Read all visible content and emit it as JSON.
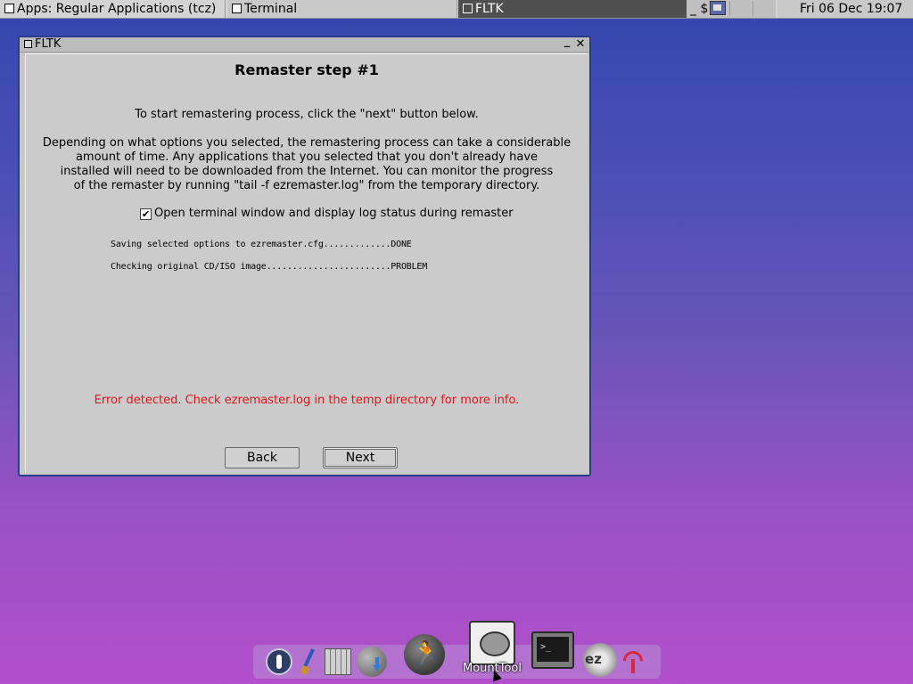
{
  "taskbar": {
    "apps_title": "Apps: Regular Applications (tcz)",
    "terminal_title": "Terminal",
    "fltk_title": "FLTK",
    "tray_text": "_ $",
    "clock": "Fri 06 Dec 19:07"
  },
  "window": {
    "title": "FLTK",
    "minimize_glyph": "_",
    "close_glyph": "✕",
    "heading": "Remaster step #1",
    "instruction": "To start remastering process, click the \"next\" button below.",
    "paragraph_lines": [
      "Depending on what options you selected, the remastering process can take a considerable",
      "amount of time.   Any applications that you selected that you don't already have",
      "installed will need to be downloaded from the Internet.  You can monitor the progress",
      "of the remaster by running \"tail -f ezremaster.log\" from the temporary directory."
    ],
    "checkbox_label": "Open terminal window and display log status during remaster",
    "checkbox_checked": true,
    "log_lines": [
      "Saving selected options to ezremaster.cfg.............DONE",
      "Checking original CD/ISO image........................PROBLEM"
    ],
    "error_text": "Error detected.  Check ezremaster.log in the temp directory for more info.",
    "error_color": "#e0141a",
    "back_label": "Back",
    "next_label": "Next"
  },
  "dock": {
    "icons": [
      "power-icon",
      "paintbrush-icon",
      "apps-grid-icon",
      "globe-download-icon",
      "run-icon",
      "mounttool-icon",
      "terminal-icon",
      "ezremaster-icon",
      "wifi-icon"
    ],
    "mounttool_label": "MountTool",
    "terminal_glyph": ">_",
    "ez_glyph": "ez"
  }
}
